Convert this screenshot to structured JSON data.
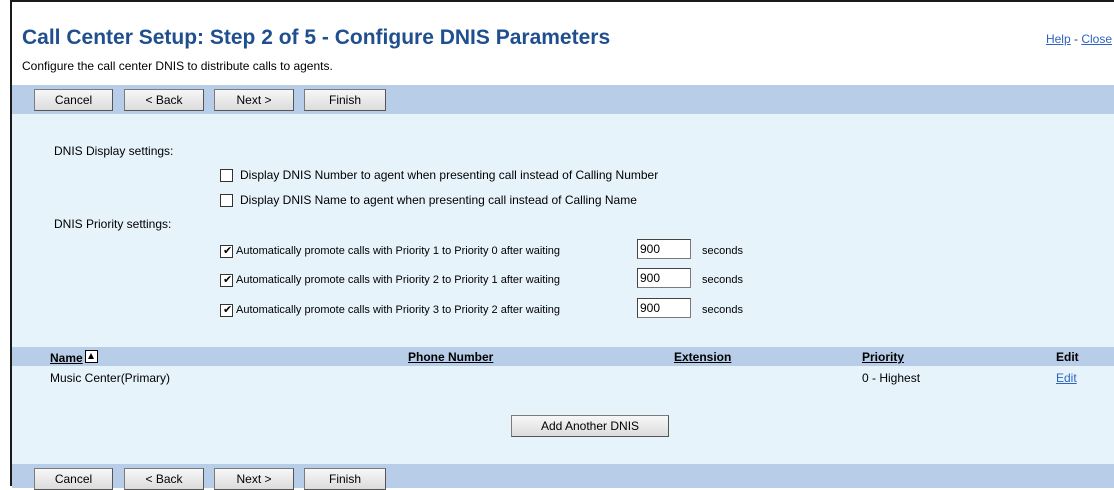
{
  "header": {
    "title": "Call Center Setup: Step 2 of 5 - Configure DNIS Parameters",
    "subtitle": "Configure the call center DNIS to distribute calls to agents.",
    "help_link": "Help",
    "separator": " - ",
    "close_link": "Close"
  },
  "toolbar": {
    "cancel_label": "Cancel",
    "back_label": "< Back",
    "next_label": "Next >",
    "finish_label": "Finish"
  },
  "display_settings": {
    "label": "DNIS Display settings:",
    "options": [
      {
        "label": "Display DNIS Number to agent when presenting call instead of Calling Number",
        "checked": false
      },
      {
        "label": "Display DNIS Name to agent when presenting call instead of Calling Name",
        "checked": false
      }
    ]
  },
  "priority_settings": {
    "label": "DNIS Priority settings:",
    "rules": [
      {
        "label": "Automatically promote calls with Priority 1 to Priority 0 after waiting",
        "checked": true,
        "value": "900",
        "unit": "seconds"
      },
      {
        "label": "Automatically promote calls with Priority 2 to Priority 1 after waiting",
        "checked": true,
        "value": "900",
        "unit": "seconds"
      },
      {
        "label": "Automatically promote calls with Priority 3 to Priority 2 after waiting",
        "checked": true,
        "value": "900",
        "unit": "seconds"
      }
    ]
  },
  "table": {
    "columns": [
      "Name",
      "Phone Number",
      "Extension",
      "Priority",
      "Edit"
    ],
    "sort_icon": "sort-ascending-icon",
    "rows": [
      {
        "name": "Music Center(Primary)",
        "phone": "",
        "extension": "",
        "priority": "0 - Highest",
        "edit": "Edit"
      }
    ],
    "add_button": "Add Another DNIS"
  },
  "colors": {
    "title": "#1f4f8f",
    "toolbar_bg": "#b8cde8",
    "content_bg": "#e6f3fb",
    "link": "#2e64c0"
  }
}
